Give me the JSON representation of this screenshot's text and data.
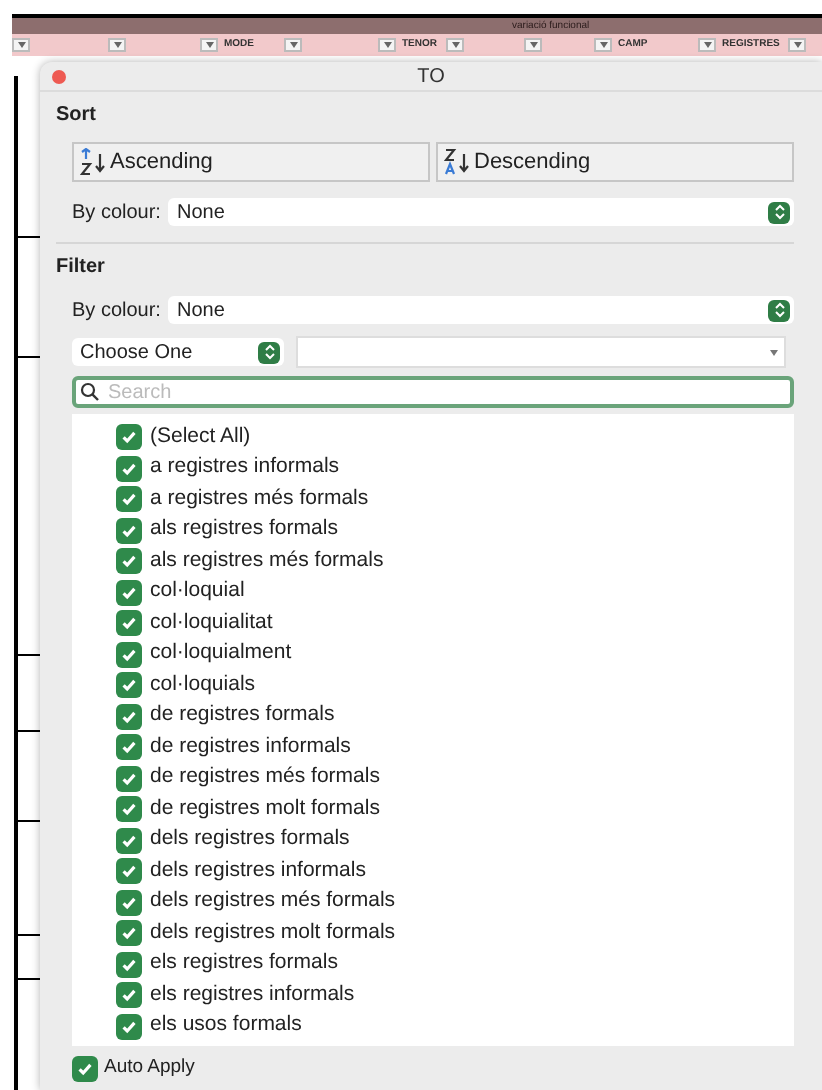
{
  "sheet": {
    "group_heading": "variació funcional",
    "columns": [
      {},
      {},
      {
        "label": "MODE"
      },
      {},
      {
        "label": "TENOR"
      },
      {},
      {},
      {
        "label": "CAMP"
      },
      {
        "label": "REGISTRES"
      },
      {}
    ]
  },
  "panel": {
    "title": "TO",
    "sort": {
      "heading": "Sort",
      "ascending": "Ascending",
      "descending": "Descending",
      "by_colour_label": "By colour:",
      "by_colour_value": "None"
    },
    "filter": {
      "heading": "Filter",
      "by_colour_label": "By colour:",
      "by_colour_value": "None",
      "condition": "Choose One",
      "search": {
        "placeholder": "Search"
      },
      "items": [
        {
          "label": "(Select All)",
          "checked": true
        },
        {
          "label": "a registres informals",
          "checked": true
        },
        {
          "label": "a registres més formals",
          "checked": true
        },
        {
          "label": "als registres formals",
          "checked": true
        },
        {
          "label": "als registres més formals",
          "checked": true
        },
        {
          "label": "col·loquial",
          "checked": true
        },
        {
          "label": "col·loquialitat",
          "checked": true
        },
        {
          "label": "col·loquialment",
          "checked": true
        },
        {
          "label": "col·loquials",
          "checked": true
        },
        {
          "label": "de registres formals",
          "checked": true
        },
        {
          "label": "de registres informals",
          "checked": true
        },
        {
          "label": "de registres més formals",
          "checked": true
        },
        {
          "label": "de registres molt formals",
          "checked": true
        },
        {
          "label": "dels registres formals",
          "checked": true
        },
        {
          "label": "dels registres informals",
          "checked": true
        },
        {
          "label": "dels registres més formals",
          "checked": true
        },
        {
          "label": "dels registres molt formals",
          "checked": true
        },
        {
          "label": "els registres formals",
          "checked": true
        },
        {
          "label": "els registres informals",
          "checked": true
        },
        {
          "label": "els usos formals",
          "checked": true
        }
      ]
    },
    "auto_apply": {
      "label": "Auto Apply",
      "checked": true
    }
  }
}
